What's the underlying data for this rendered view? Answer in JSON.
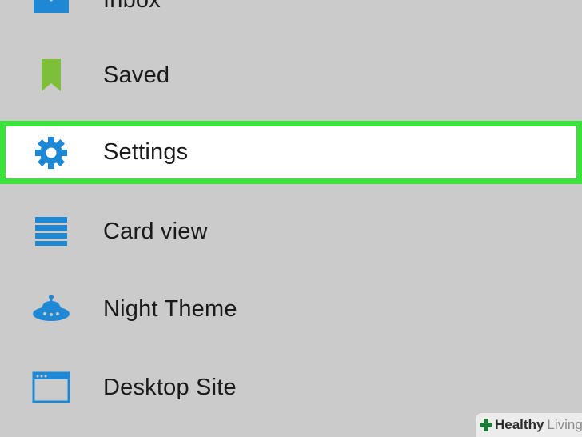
{
  "colors": {
    "background": "#cbcbcb",
    "selected_border": "#3ae33a",
    "selected_bg": "#ffffff",
    "icon_blue": "#1e88d4",
    "bookmark_green": "#7cbf3b"
  },
  "menu": {
    "items": [
      {
        "label": "Inbox",
        "icon": "envelope-icon"
      },
      {
        "label": "Saved",
        "icon": "bookmark-icon"
      },
      {
        "label": "Settings",
        "icon": "gear-icon",
        "selected": true
      },
      {
        "label": "Card view",
        "icon": "card-view-icon"
      },
      {
        "label": "Night Theme",
        "icon": "ufo-icon"
      },
      {
        "label": "Desktop Site",
        "icon": "browser-window-icon"
      }
    ]
  },
  "watermark": {
    "part1": "Healthy",
    "part2": "Living",
    "icon": "plus-cross-icon"
  }
}
